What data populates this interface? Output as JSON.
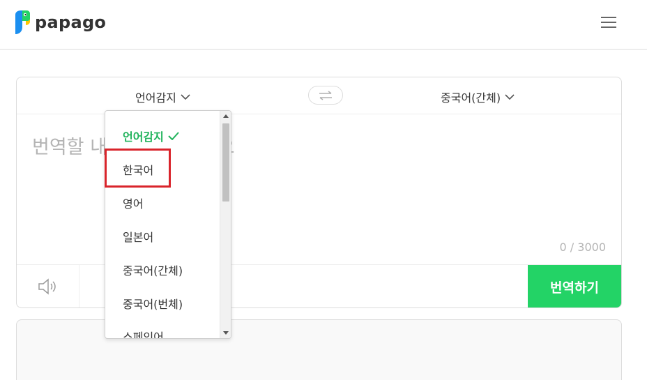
{
  "app": {
    "logo_text": "papago",
    "brand_colors": {
      "green": "#23d366",
      "blue": "#1b8ff0",
      "yellow": "#ffc800"
    }
  },
  "language_bar": {
    "source_label": "언어감지",
    "target_label": "중국어(간체)",
    "swap_icon": "swap-arrows-icon"
  },
  "source": {
    "placeholder": "번역할 내용을 입력하세요",
    "char_count": "0 / 3000"
  },
  "toolbar": {
    "speaker_icon": "speaker-icon",
    "second_icon": "handwriting-icon",
    "translate_label": "번역하기",
    "translate_color": "#23d366"
  },
  "dropdown": {
    "items": [
      {
        "label": "언어감지",
        "selected": true
      },
      {
        "label": "한국어",
        "selected": false,
        "highlighted": true
      },
      {
        "label": "영어",
        "selected": false
      },
      {
        "label": "일본어",
        "selected": false
      },
      {
        "label": "중국어(간체)",
        "selected": false
      },
      {
        "label": "중국어(번체)",
        "selected": false
      },
      {
        "label": "스페인어",
        "selected": false
      }
    ],
    "selected_color": "#21b35c",
    "highlight_color": "#d9242b"
  }
}
